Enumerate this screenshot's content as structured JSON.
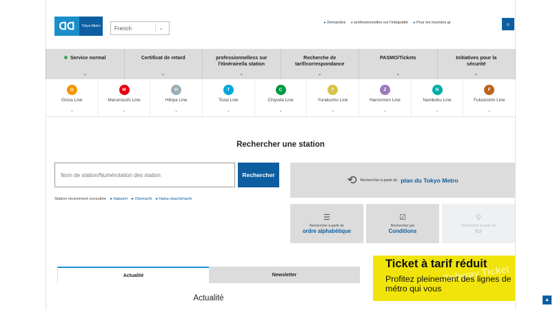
{
  "header": {
    "logo_text": "Tokyo Metro",
    "language": "French",
    "top_links": [
      "Demandes",
      "professionnelles sur l'intégralité",
      "Pour les touristes gr"
    ],
    "search_icon": "search-icon"
  },
  "nav": [
    {
      "label": "Service normal",
      "status_color": "#3aa457"
    },
    {
      "label": "Certificat de retard"
    },
    {
      "label": "professionnelless sur l'itinéraire/la station"
    },
    {
      "label": "Recherche de tarif/correspondance"
    },
    {
      "label": "PASMO/Tickets"
    },
    {
      "label": "Initiatives pour la sécurité"
    }
  ],
  "lines": [
    {
      "code": "G",
      "name": "Ginza Line",
      "color": "#f39700"
    },
    {
      "code": "M",
      "name": "Marunouchi Line",
      "color": "#e60012"
    },
    {
      "code": "H",
      "name": "Hibiya Line",
      "color": "#9caeb7"
    },
    {
      "code": "T",
      "name": "Tozai Line",
      "color": "#00a7db"
    },
    {
      "code": "C",
      "name": "Chiyoda Line",
      "color": "#009944"
    },
    {
      "code": "Y",
      "name": "Yurakucho Line",
      "color": "#d7c447"
    },
    {
      "code": "Z",
      "name": "Hanzomon Line",
      "color": "#9b7cb6"
    },
    {
      "code": "N",
      "name": "Namboku Line",
      "color": "#00ada9"
    },
    {
      "code": "F",
      "name": "Fukutoshin Line",
      "color": "#bb641d"
    }
  ],
  "search": {
    "title": "Rechercher une station",
    "placeholder": "Nom de station/Numérotation des station",
    "button": "Rechercher",
    "recent_label": "Station récemment consultée",
    "recent": [
      "Itabashi",
      "Otemachi",
      "Naka-okachimachi"
    ]
  },
  "map_button": {
    "pre": "Rechercher à partir du",
    "main": "plan du Tokyo Metro"
  },
  "tiles": [
    {
      "pre": "Rechercher à partir de",
      "main": "ordre alphabétique",
      "icon": "list-icon"
    },
    {
      "pre": "Rechercher par",
      "main": "Conditions",
      "icon": "checkbox-icon"
    },
    {
      "pre": "Rechercher à partir de",
      "main": "Ici",
      "icon": "location-pin-icon"
    }
  ],
  "tabs": [
    "Actualité",
    "Newsletter"
  ],
  "news_title": "Actualité",
  "banner": {
    "line1": "Ticket à tarif réduit",
    "line2": "Profitez pleinement des lignes de métro qui vous",
    "watermark": "Subway Ticket"
  },
  "page_top": "▲"
}
